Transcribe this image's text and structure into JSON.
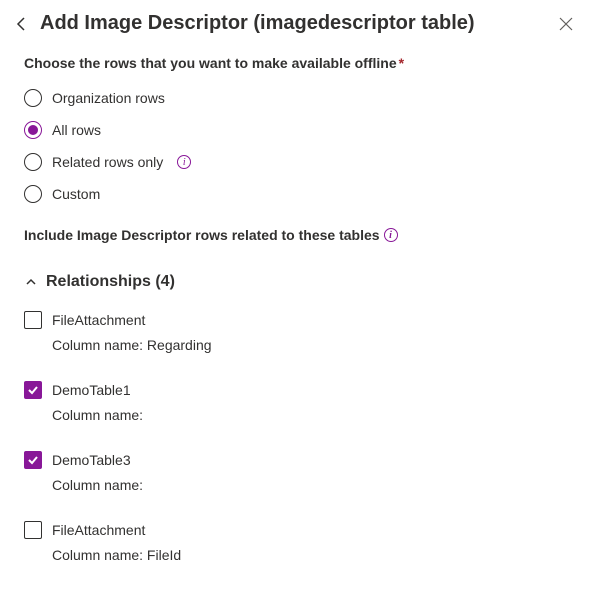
{
  "header": {
    "title": "Add Image Descriptor (imagedescriptor table)"
  },
  "prompt": {
    "choose_rows": "Choose the rows that you want to make available offline"
  },
  "radio_options": {
    "organization": "Organization rows",
    "all": "All rows",
    "related": "Related rows only",
    "custom": "Custom"
  },
  "include_label": "Include Image Descriptor rows related to these tables",
  "relationships": {
    "title": "Relationships (4)",
    "items": [
      {
        "name": "FileAttachment",
        "column_label": "Column name: Regarding",
        "checked": false
      },
      {
        "name": "DemoTable1",
        "column_label": "Column name:",
        "checked": true
      },
      {
        "name": "DemoTable3",
        "column_label": "Column name:",
        "checked": true
      },
      {
        "name": "FileAttachment",
        "column_label": "Column name: FileId",
        "checked": false
      }
    ]
  }
}
